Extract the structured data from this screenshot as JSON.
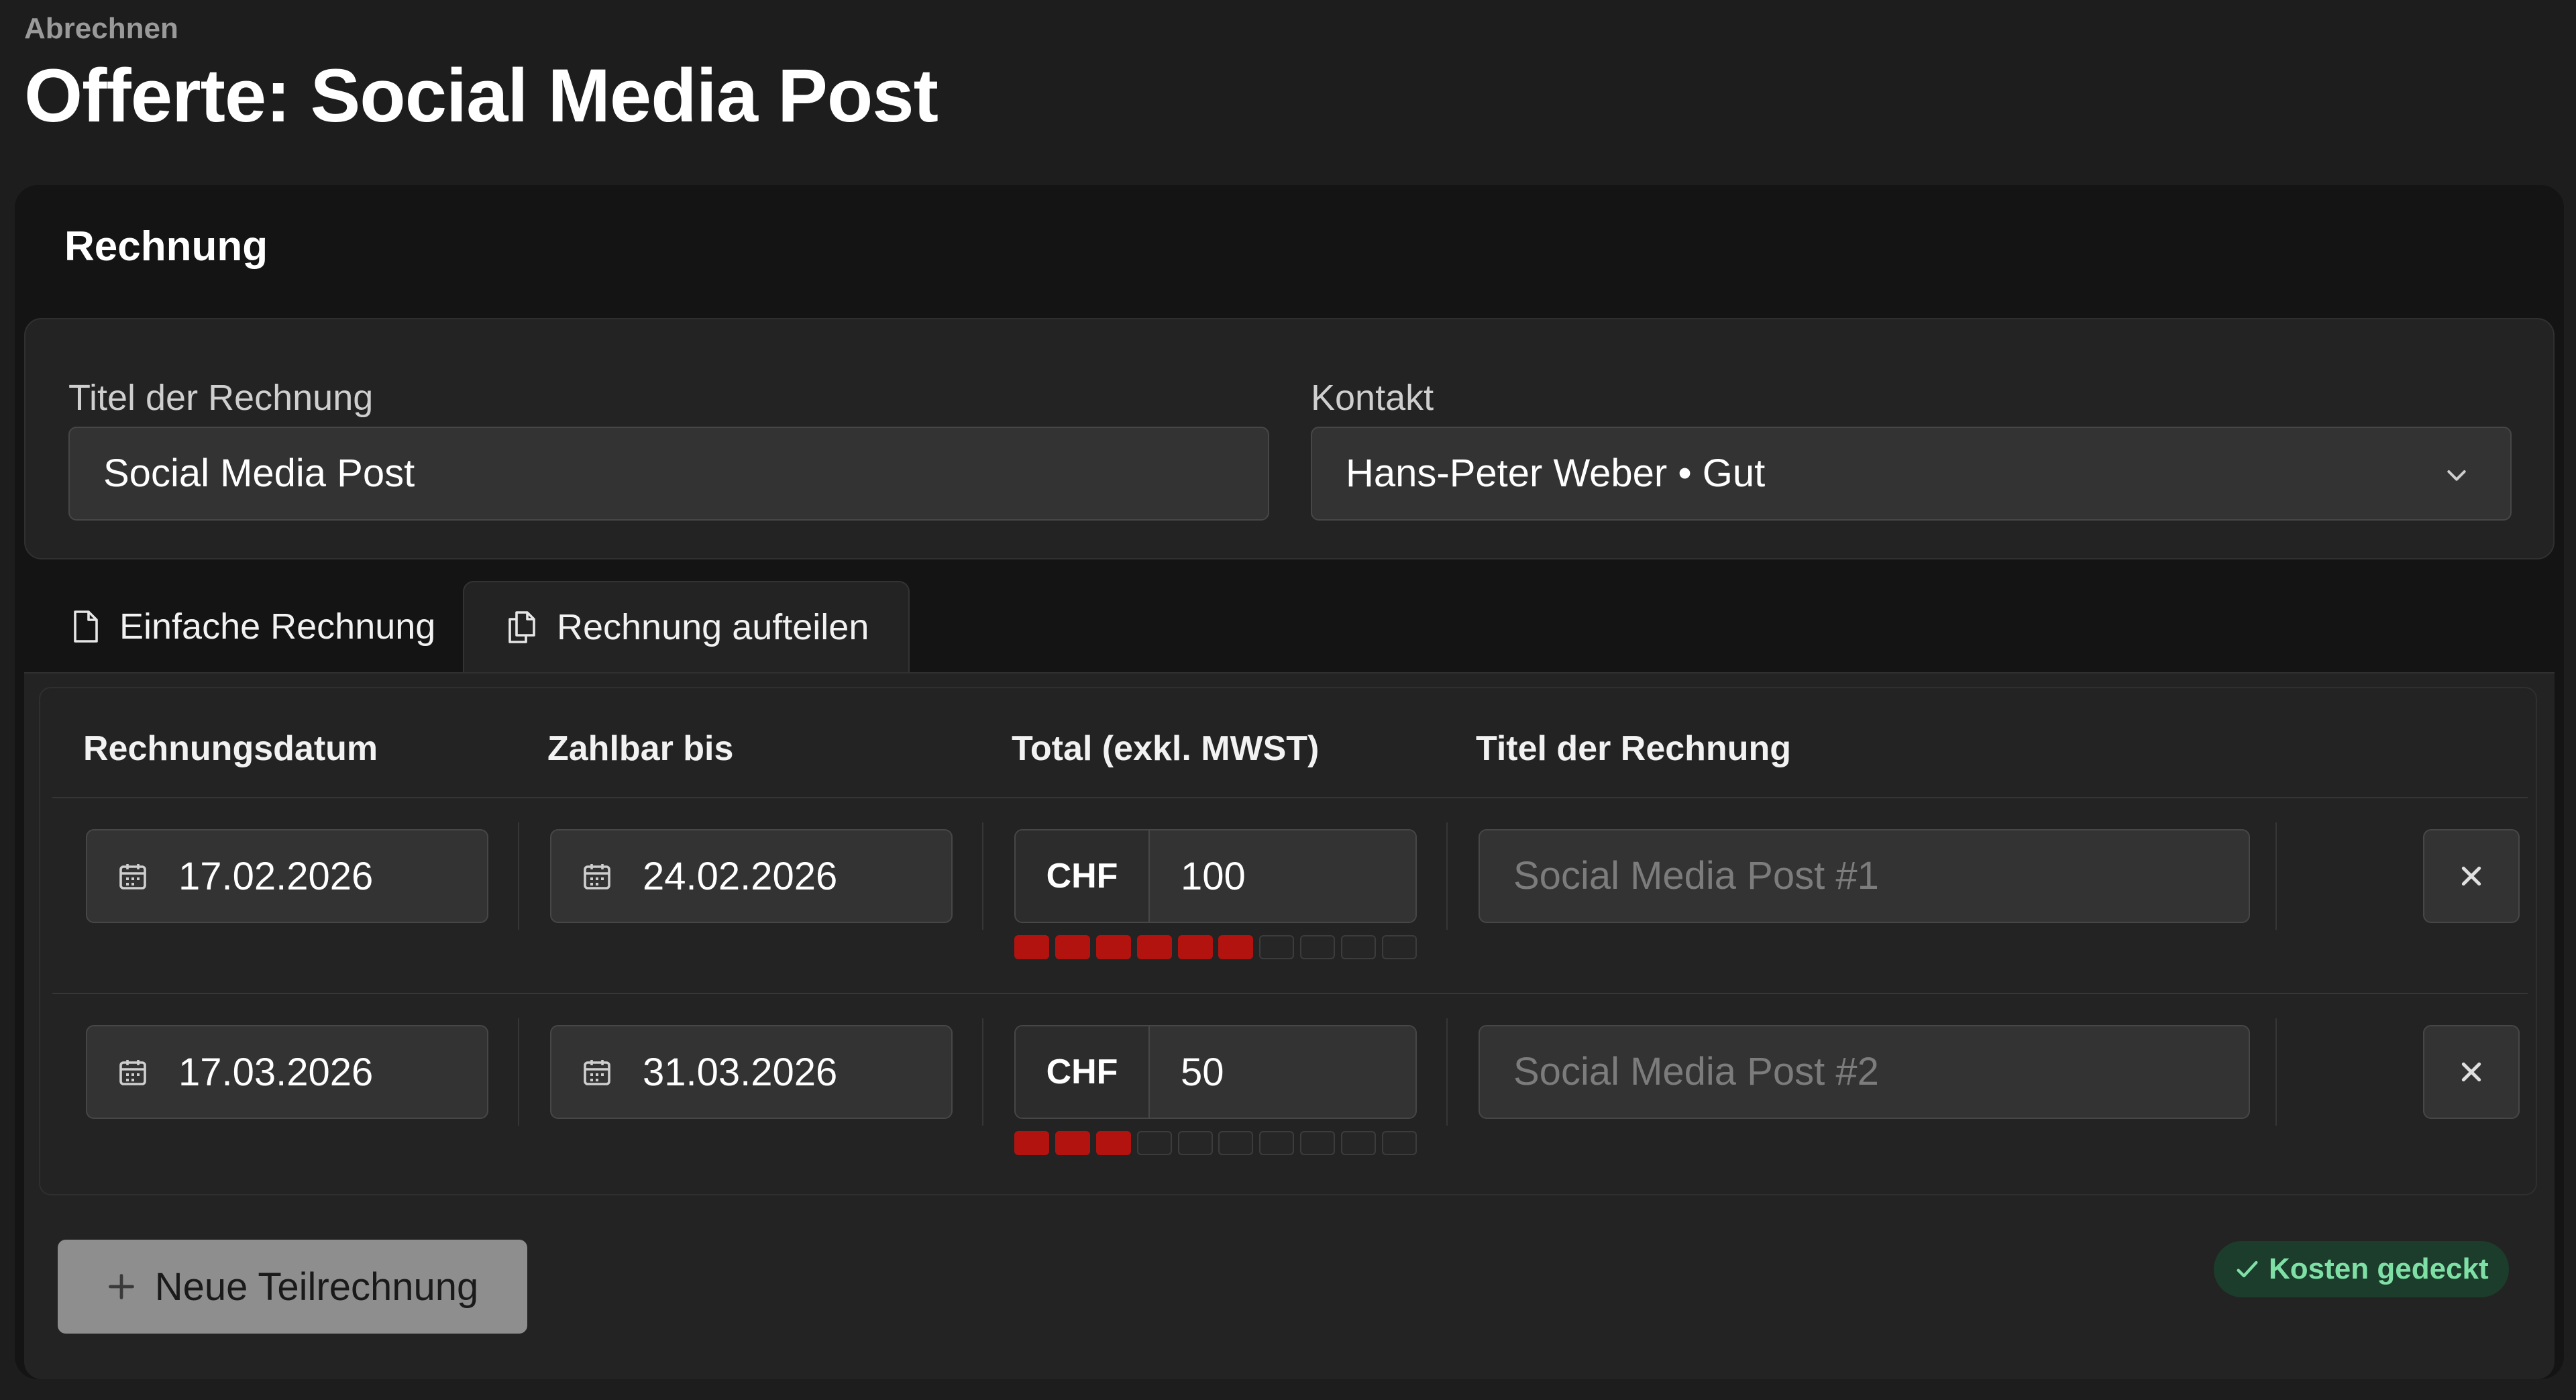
{
  "breadcrumb": "Abrechnen",
  "page_title": "Offerte: Social Media Post",
  "section_title": "Rechnung",
  "form": {
    "title_label": "Titel der Rechnung",
    "title_value": "Social Media Post",
    "contact_label": "Kontakt",
    "contact_value": "Hans-Peter Weber • Gut"
  },
  "tabs": [
    {
      "label": "Einfache Rechnung",
      "icon": "document-icon",
      "active": false
    },
    {
      "label": "Rechnung aufteilen",
      "icon": "copy-documents-icon",
      "active": true
    }
  ],
  "table": {
    "headers": [
      "Rechnungsdatum",
      "Zahlbar bis",
      "Total (exkl. MWST)",
      "Titel der Rechnung"
    ],
    "rows": [
      {
        "invoice_date": "17.02.2026",
        "due_date": "24.02.2026",
        "currency": "CHF",
        "amount": "100",
        "share_filled": 6,
        "share_total": 10,
        "title_placeholder": "Social Media Post #1"
      },
      {
        "invoice_date": "17.03.2026",
        "due_date": "31.03.2026",
        "currency": "CHF",
        "amount": "50",
        "share_filled": 3,
        "share_total": 10,
        "title_placeholder": "Social Media Post #2"
      }
    ]
  },
  "add_button_label": "Neue Teilrechnung",
  "status_badge": "Kosten gedeckt",
  "colors": {
    "segment_on": "#b3130f",
    "badge_text": "#7fe0a6",
    "badge_bg": "#1c3d2c"
  }
}
